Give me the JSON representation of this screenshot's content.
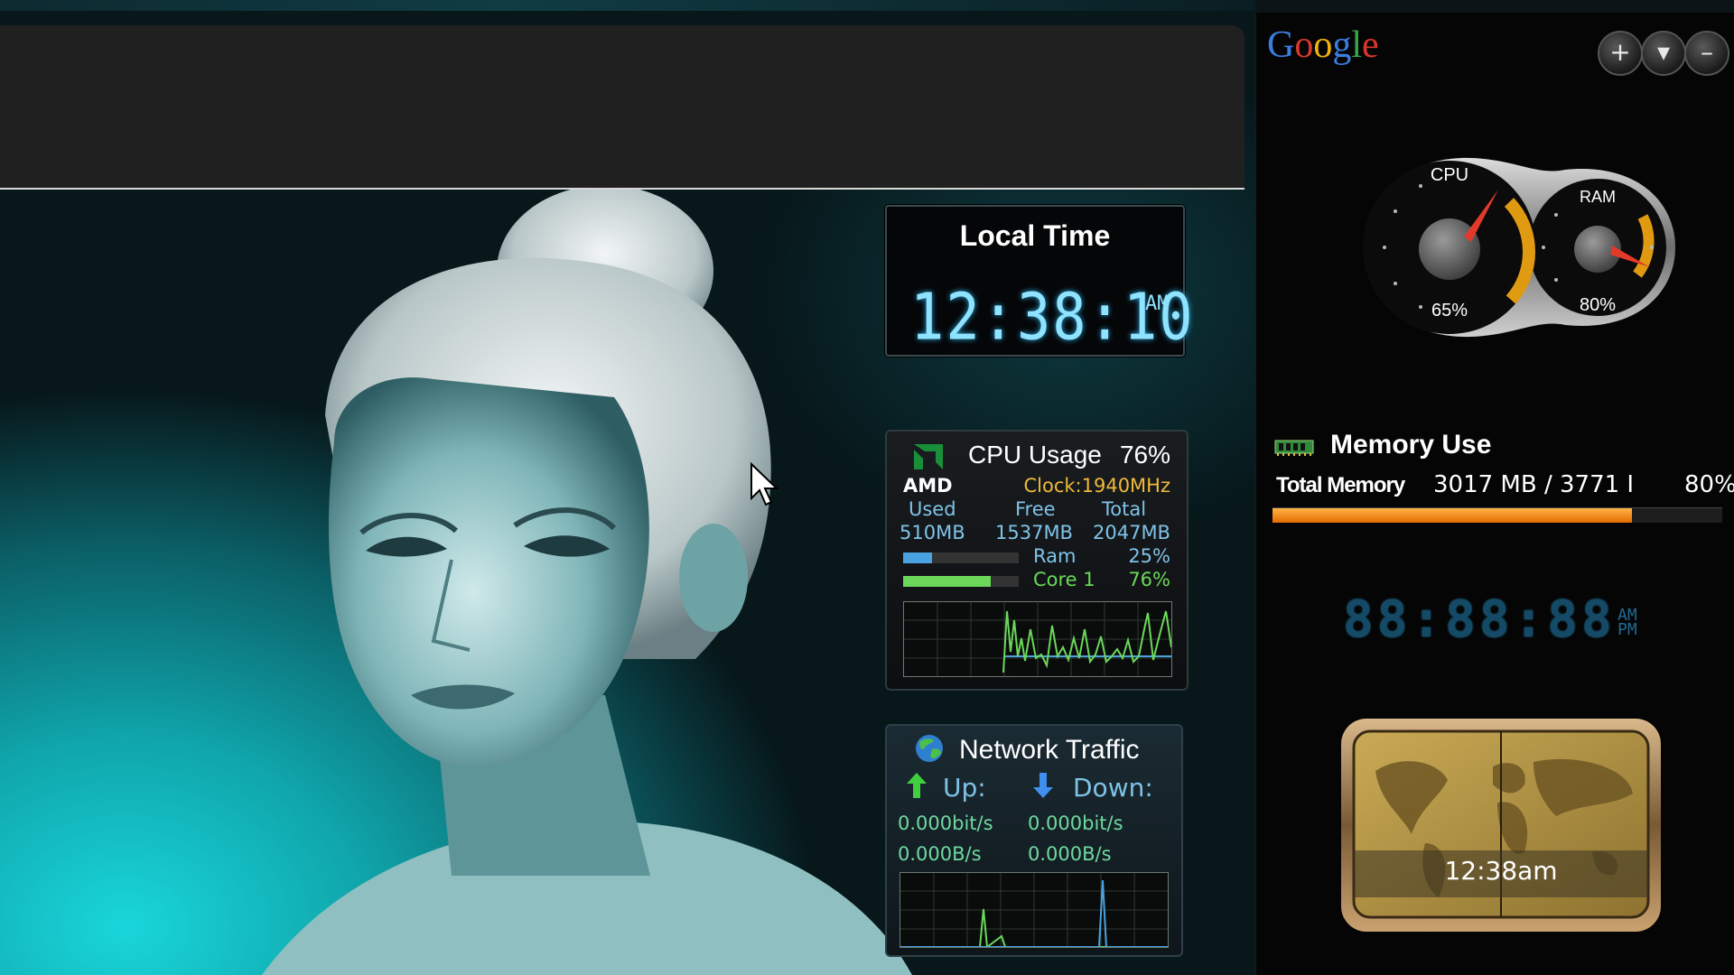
{
  "desktop": {
    "wallpaper": "woman-portrait-teal"
  },
  "local_time_gadget": {
    "title": "Local Time",
    "time": "12:38:10",
    "ampm": "AM"
  },
  "cpu_gadget": {
    "brand": "AMD",
    "title": "CPU Usage",
    "percent": "76%",
    "clock": "Clock:1940MHz",
    "headers": {
      "used": "Used",
      "free": "Free",
      "total": "Total"
    },
    "values": {
      "used": "510MB",
      "free": "1537MB",
      "total": "2047MB"
    },
    "ram": {
      "label": "Ram",
      "percent": "25%",
      "level": 0.25
    },
    "core": {
      "label": "Core 1",
      "percent": "76%",
      "level": 0.76
    },
    "colors": {
      "clock": "#f0b93a",
      "ram_bar": "#4aa3e0",
      "core_bar": "#6bd85a"
    }
  },
  "network_gadget": {
    "title": "Network Traffic",
    "up_label": "Up:",
    "down_label": "Down:",
    "up_bits": "0.000bit/s",
    "down_bits": "0.000bit/s",
    "up_bytes": "0.000B/s",
    "down_bytes": "0.000B/s"
  },
  "sidebar": {
    "logo": [
      "G",
      "o",
      "o",
      "g",
      "l",
      "e"
    ],
    "logo_colors": [
      "#3a7fe0",
      "#d8382c",
      "#f2b20e",
      "#3a7fe0",
      "#3aa64a",
      "#d8382c"
    ],
    "buttons": {
      "add": "+",
      "menu": "▾",
      "minimize": "–"
    },
    "gauge": {
      "cpu_label": "CPU",
      "cpu_value": "65%",
      "cpu_level": 0.65,
      "ram_label": "RAM",
      "ram_value": "80%",
      "ram_level": 0.8
    },
    "memory": {
      "title": "Memory Use",
      "label": "Total Memory",
      "values": "3017 MB / 3771 I",
      "percent": "80%",
      "level": 0.8,
      "bar_color": "#f28c1c"
    },
    "digital_clock": {
      "digits": "88:88:88",
      "am": "AM",
      "pm": "PM"
    },
    "world_clock": {
      "time": "12:38am"
    }
  }
}
